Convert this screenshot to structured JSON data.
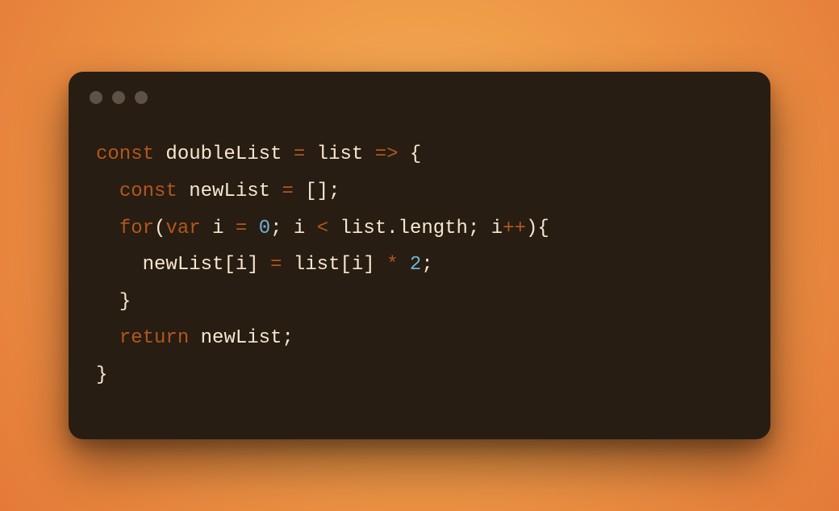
{
  "colors": {
    "window_bg": "#271d12",
    "traffic_dot": "#5e5146",
    "keyword": "#b3571f",
    "identifier": "#f6e7d0",
    "operator": "#b3571f",
    "number": "#6fb3d0"
  },
  "code": {
    "tokens": [
      [
        {
          "t": "keyword",
          "v": "const"
        },
        {
          "t": "ws",
          "v": " "
        },
        {
          "t": "def",
          "v": "doubleList"
        },
        {
          "t": "ws",
          "v": " "
        },
        {
          "t": "op",
          "v": "="
        },
        {
          "t": "ws",
          "v": " "
        },
        {
          "t": "ident",
          "v": "list"
        },
        {
          "t": "ws",
          "v": " "
        },
        {
          "t": "op",
          "v": "=>"
        },
        {
          "t": "ws",
          "v": " "
        },
        {
          "t": "punct",
          "v": "{"
        }
      ],
      [
        {
          "t": "ws",
          "v": "  "
        },
        {
          "t": "keyword",
          "v": "const"
        },
        {
          "t": "ws",
          "v": " "
        },
        {
          "t": "def",
          "v": "newList"
        },
        {
          "t": "ws",
          "v": " "
        },
        {
          "t": "op",
          "v": "="
        },
        {
          "t": "ws",
          "v": " "
        },
        {
          "t": "punct",
          "v": "[];"
        }
      ],
      [
        {
          "t": "ws",
          "v": "  "
        },
        {
          "t": "keyword",
          "v": "for"
        },
        {
          "t": "punct",
          "v": "("
        },
        {
          "t": "keyword",
          "v": "var"
        },
        {
          "t": "ws",
          "v": " "
        },
        {
          "t": "ident",
          "v": "i"
        },
        {
          "t": "ws",
          "v": " "
        },
        {
          "t": "op",
          "v": "="
        },
        {
          "t": "ws",
          "v": " "
        },
        {
          "t": "num",
          "v": "0"
        },
        {
          "t": "punct",
          "v": ";"
        },
        {
          "t": "ws",
          "v": " "
        },
        {
          "t": "ident",
          "v": "i"
        },
        {
          "t": "ws",
          "v": " "
        },
        {
          "t": "op",
          "v": "<"
        },
        {
          "t": "ws",
          "v": " "
        },
        {
          "t": "ident",
          "v": "list"
        },
        {
          "t": "punct",
          "v": "."
        },
        {
          "t": "prop",
          "v": "length"
        },
        {
          "t": "punct",
          "v": ";"
        },
        {
          "t": "ws",
          "v": " "
        },
        {
          "t": "ident",
          "v": "i"
        },
        {
          "t": "op",
          "v": "++"
        },
        {
          "t": "punct",
          "v": "){"
        }
      ],
      [
        {
          "t": "ws",
          "v": "    "
        },
        {
          "t": "ident",
          "v": "newList"
        },
        {
          "t": "punct",
          "v": "["
        },
        {
          "t": "ident",
          "v": "i"
        },
        {
          "t": "punct",
          "v": "]"
        },
        {
          "t": "ws",
          "v": " "
        },
        {
          "t": "op",
          "v": "="
        },
        {
          "t": "ws",
          "v": " "
        },
        {
          "t": "ident",
          "v": "list"
        },
        {
          "t": "punct",
          "v": "["
        },
        {
          "t": "ident",
          "v": "i"
        },
        {
          "t": "punct",
          "v": "]"
        },
        {
          "t": "ws",
          "v": " "
        },
        {
          "t": "op",
          "v": "*"
        },
        {
          "t": "ws",
          "v": " "
        },
        {
          "t": "num",
          "v": "2"
        },
        {
          "t": "punct",
          "v": ";"
        }
      ],
      [
        {
          "t": "ws",
          "v": "  "
        },
        {
          "t": "punct",
          "v": "}"
        }
      ],
      [
        {
          "t": "ws",
          "v": "  "
        },
        {
          "t": "keyword",
          "v": "return"
        },
        {
          "t": "ws",
          "v": " "
        },
        {
          "t": "ident",
          "v": "newList"
        },
        {
          "t": "punct",
          "v": ";"
        }
      ],
      [
        {
          "t": "punct",
          "v": "}"
        }
      ]
    ]
  }
}
